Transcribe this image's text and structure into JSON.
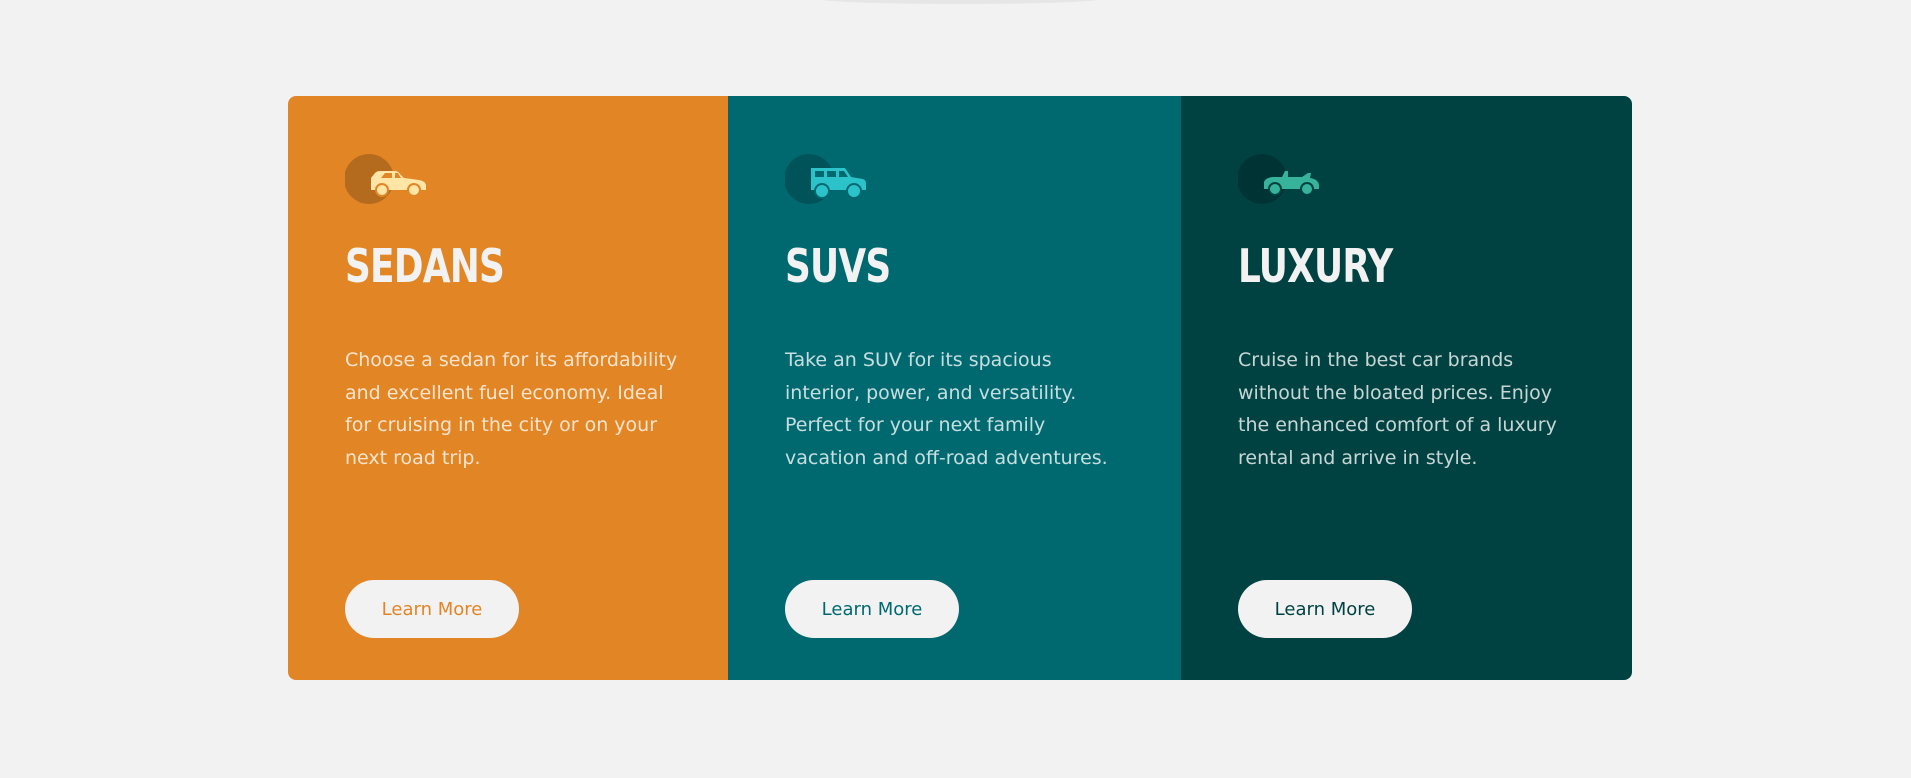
{
  "cards": [
    {
      "title": "SEDANS",
      "description": "Choose a sedan for its affordability and excellent fuel economy. Ideal for cruising in the city or on your next road trip.",
      "button_label": "Learn More",
      "icon": "sedan-car-icon",
      "bg_color": "#e28625",
      "button_text_color": "#e28625",
      "icon_color": "#ffe5a6"
    },
    {
      "title": "SUVS",
      "description": "Take an SUV for its spacious interior, power, and versatility. Perfect for your next family vacation and off-road adventures.",
      "button_label": "Learn More",
      "icon": "suv-car-icon",
      "bg_color": "#006970",
      "button_text_color": "#006970",
      "icon_color": "#2bc3c9"
    },
    {
      "title": "LUXURY",
      "description": "Cruise in the best car brands without the bloated prices. Enjoy the enhanced comfort of a luxury rental and arrive in style.",
      "button_label": "Learn More",
      "icon": "luxury-convertible-icon",
      "bg_color": "#004241",
      "button_text_color": "#004241",
      "icon_color": "#36b39a"
    }
  ]
}
